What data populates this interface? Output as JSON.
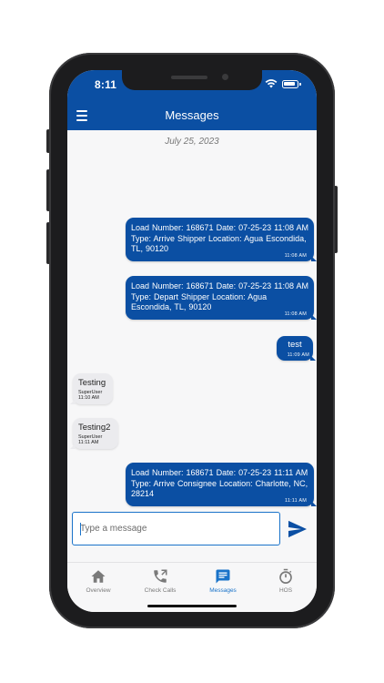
{
  "status_bar": {
    "time": "8:11"
  },
  "app_bar": {
    "title": "Messages"
  },
  "thread": {
    "date": "July 25, 2023",
    "messages": [
      {
        "direction": "outgoing",
        "text": "Load Number: 168671   Date: 07-25-23 11:08 AM   Type: Arrive Shipper   Location: Agua Escondida, TL, 90120",
        "time": "11:08 AM"
      },
      {
        "direction": "outgoing",
        "text": "Load Number: 168671   Date: 07-25-23 11:08 AM   Type: Depart Shipper   Location: Agua Escondida, TL, 90120",
        "time": "11:08 AM"
      },
      {
        "direction": "outgoing",
        "text": "test",
        "time": "11:09 AM"
      },
      {
        "direction": "incoming",
        "text": "Testing",
        "sender": "SuperUser",
        "time": "11:10 AM"
      },
      {
        "direction": "incoming",
        "text": "Testing2",
        "sender": "SuperUser",
        "time": "11:11 AM"
      },
      {
        "direction": "outgoing",
        "text": "Load Number: 168671   Date: 07-25-23 11:11 AM   Type: Arrive Consignee   Location: Charlotte, NC, 28214",
        "time": "11:11 AM"
      }
    ]
  },
  "composer": {
    "placeholder": "Type a message",
    "value": ""
  },
  "tabs": [
    {
      "label": "Overview",
      "icon": "home-icon",
      "active": false
    },
    {
      "label": "Check Calls",
      "icon": "phone-call-icon",
      "active": false
    },
    {
      "label": "Messages",
      "icon": "message-icon",
      "active": true
    },
    {
      "label": "HOS",
      "icon": "timer-icon",
      "active": false
    }
  ],
  "colors": {
    "primary": "#0b4fa3",
    "accent": "#1a73c9",
    "incoming_bubble": "#ebebee",
    "inactive_tab": "#7a7a7a"
  }
}
